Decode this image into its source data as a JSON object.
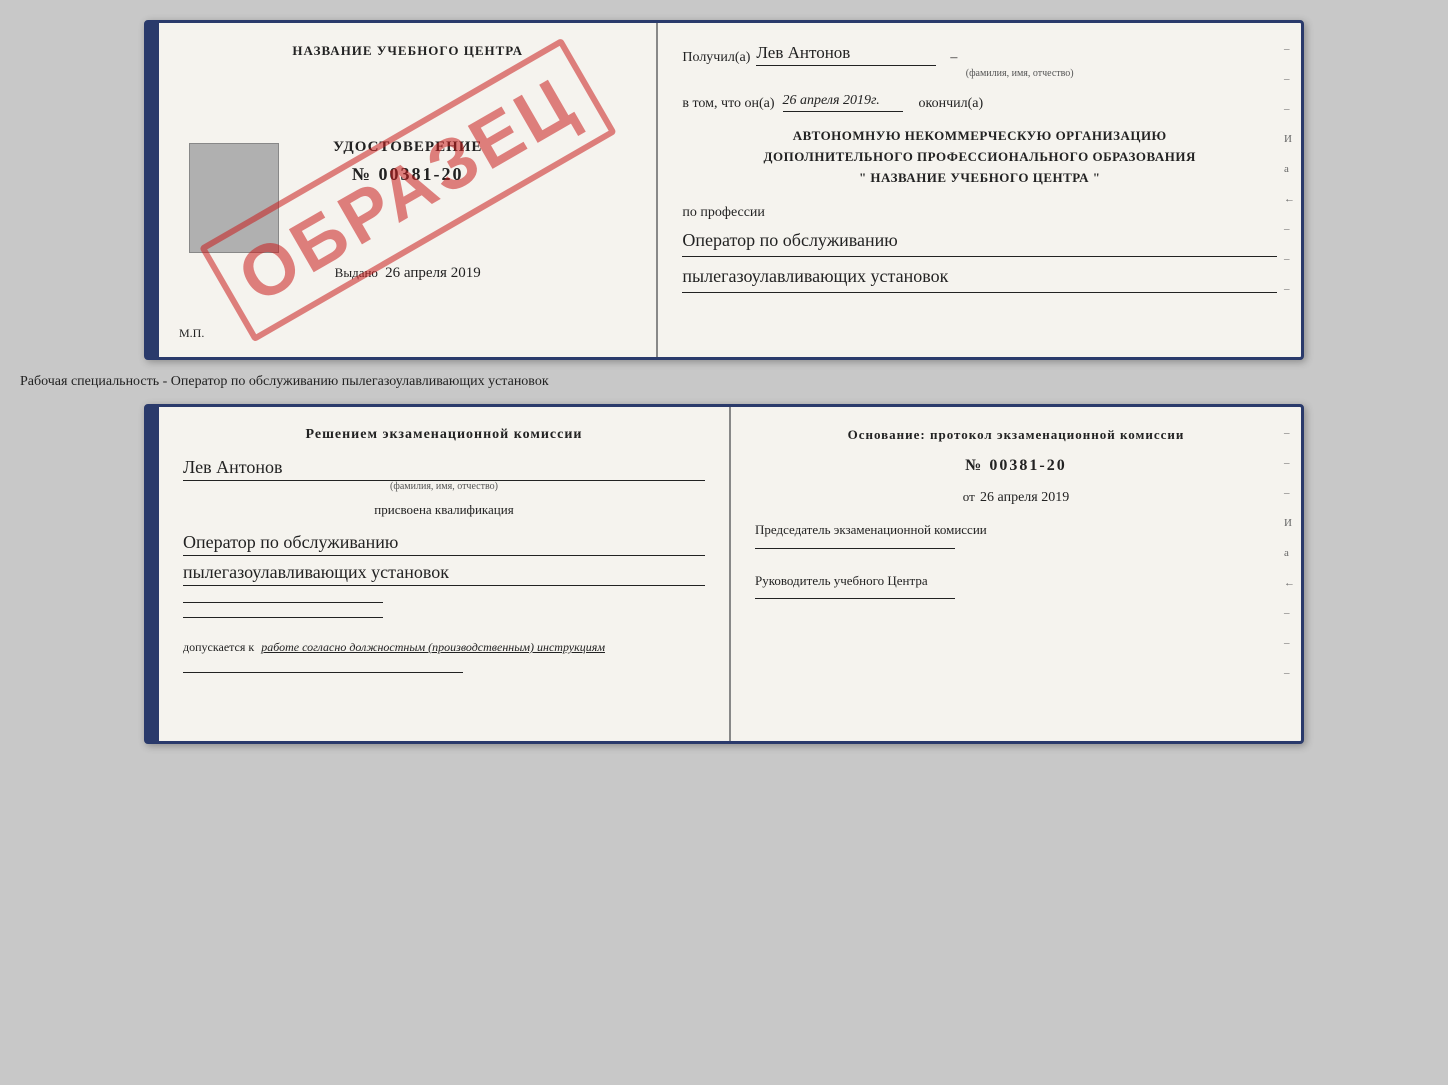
{
  "page": {
    "background": "#c8c8c8"
  },
  "top_book": {
    "left": {
      "institution_name": "НАЗВАНИЕ УЧЕБНОГО ЦЕНТРА",
      "watermark": "ОБРАЗЕЦ",
      "cert_type": "УДОСТОВЕРЕНИЕ",
      "cert_number": "№ 00381-20",
      "issued_label": "Выдано",
      "issued_date": "26 апреля 2019",
      "mp_label": "М.П."
    },
    "right": {
      "recipient_label": "Получил(а)",
      "recipient_name": "Лев Антонов",
      "fio_sublabel": "(фамилия, имя, отчество)",
      "in_that_label": "в том, что он(а)",
      "completed_date": "26 апреля 2019г.",
      "completed_label": "окончил(а)",
      "org_line1": "АВТОНОМНУЮ НЕКОММЕРЧЕСКУЮ ОРГАНИЗАЦИЮ",
      "org_line2": "ДОПОЛНИТЕЛЬНОГО ПРОФЕССИОНАЛЬНОГО ОБРАЗОВАНИЯ",
      "org_line3": "\"  НАЗВАНИЕ УЧЕБНОГО ЦЕНТРА  \"",
      "profession_label": "по профессии",
      "profession_line1": "Оператор по обслуживанию",
      "profession_line2": "пылегазоулавливающих установок",
      "side_marks": [
        "-",
        "-",
        "-",
        "И",
        "а",
        "←",
        "-",
        "-",
        "-"
      ]
    }
  },
  "middle_text": "Рабочая специальность - Оператор по обслуживанию пылегазоулавливающих установок",
  "bottom_book": {
    "left": {
      "decision_title": "Решением экзаменационной комиссии",
      "recipient_name": "Лев Антонов",
      "fio_sublabel": "(фамилия, имя, отчество)",
      "qualification_label": "присвоена квалификация",
      "qualification_line1": "Оператор по обслуживанию",
      "qualification_line2": "пылегазоулавливающих установок",
      "allowed_prefix": "допускается к",
      "allowed_text": "работе согласно должностным (производственным) инструкциям"
    },
    "right": {
      "basis_label": "Основание: протокол экзаменационной комиссии",
      "protocol_number": "№ 00381-20",
      "date_prefix": "от",
      "protocol_date": "26 апреля 2019",
      "chairman_label": "Председатель экзаменационной комиссии",
      "director_label": "Руководитель учебного Центра",
      "side_marks": [
        "-",
        "-",
        "-",
        "И",
        "а",
        "←",
        "-",
        "-",
        "-"
      ]
    }
  }
}
